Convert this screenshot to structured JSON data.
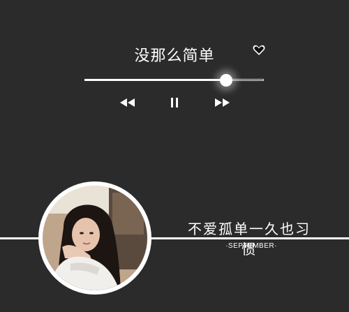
{
  "player": {
    "song_title": "没那么简单",
    "favorite_icon": "heart-icon",
    "progress_fraction": 0.79,
    "controls": {
      "previous_icon": "rewind-icon",
      "pause_icon": "pause-icon",
      "next_icon": "fast-forward-icon"
    }
  },
  "banner": {
    "avatar_icon": "avatar-photo",
    "lyric": "不爱孤单一久也习惯",
    "month": "·SEPTEMBER·"
  },
  "colors": {
    "background": "#2b2b2b",
    "foreground": "#ffffff"
  }
}
